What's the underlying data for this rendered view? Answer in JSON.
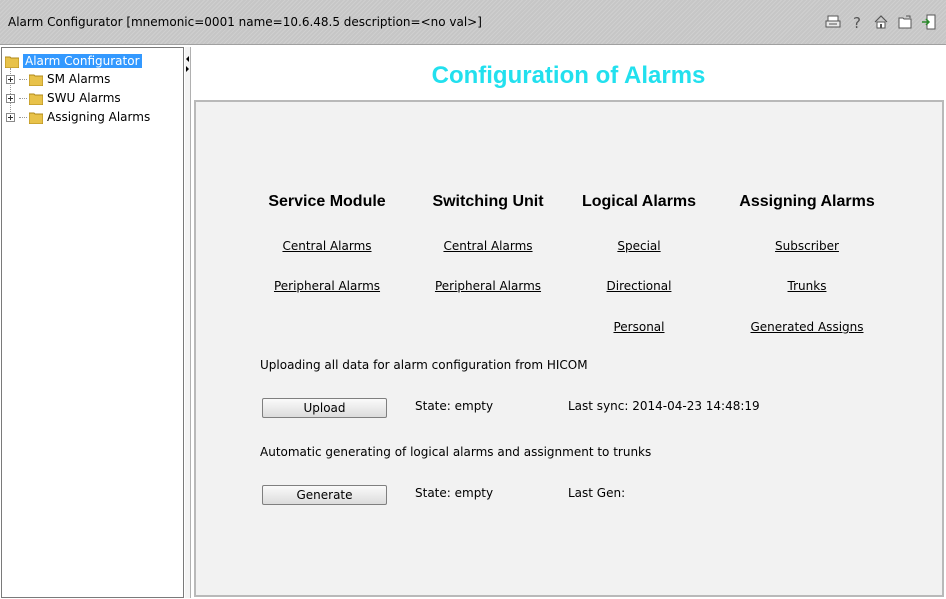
{
  "window": {
    "title": "Alarm Configurator [mnemonic=0001 name=10.6.48.5 description=<no val>]",
    "toolbar": [
      "print-icon",
      "help-icon",
      "home-icon",
      "folder-icon",
      "exit-icon"
    ]
  },
  "tree": {
    "root": "Alarm Configurator",
    "items": [
      "SM Alarms",
      "SWU Alarms",
      "Assigning Alarms"
    ]
  },
  "main": {
    "title": "Configuration of Alarms",
    "columns": [
      {
        "heading": "Service Module",
        "links": [
          "Central Alarms",
          "Peripheral Alarms"
        ]
      },
      {
        "heading": "Switching Unit",
        "links": [
          "Central Alarms",
          "Peripheral Alarms"
        ]
      },
      {
        "heading": "Logical Alarms",
        "links": [
          "Special",
          "Directional",
          "Personal"
        ]
      },
      {
        "heading": "Assigning Alarms",
        "links": [
          "Subscriber",
          "Trunks",
          "Generated Assigns"
        ]
      }
    ],
    "upload": {
      "description": "Uploading all data for alarm configuration from HICOM",
      "button_label": "Upload",
      "state": "State: empty",
      "last_sync": "Last sync: 2014-04-23 14:48:19"
    },
    "generate": {
      "description": "Automatic generating of logical alarms and assignment to trunks",
      "button_label": "Generate",
      "state": "State: empty",
      "last_gen": "Last Gen:"
    }
  },
  "colors": {
    "title_accent": "#22e0ee",
    "selection": "#3399ff",
    "panel_bg": "#f2f2f2"
  }
}
